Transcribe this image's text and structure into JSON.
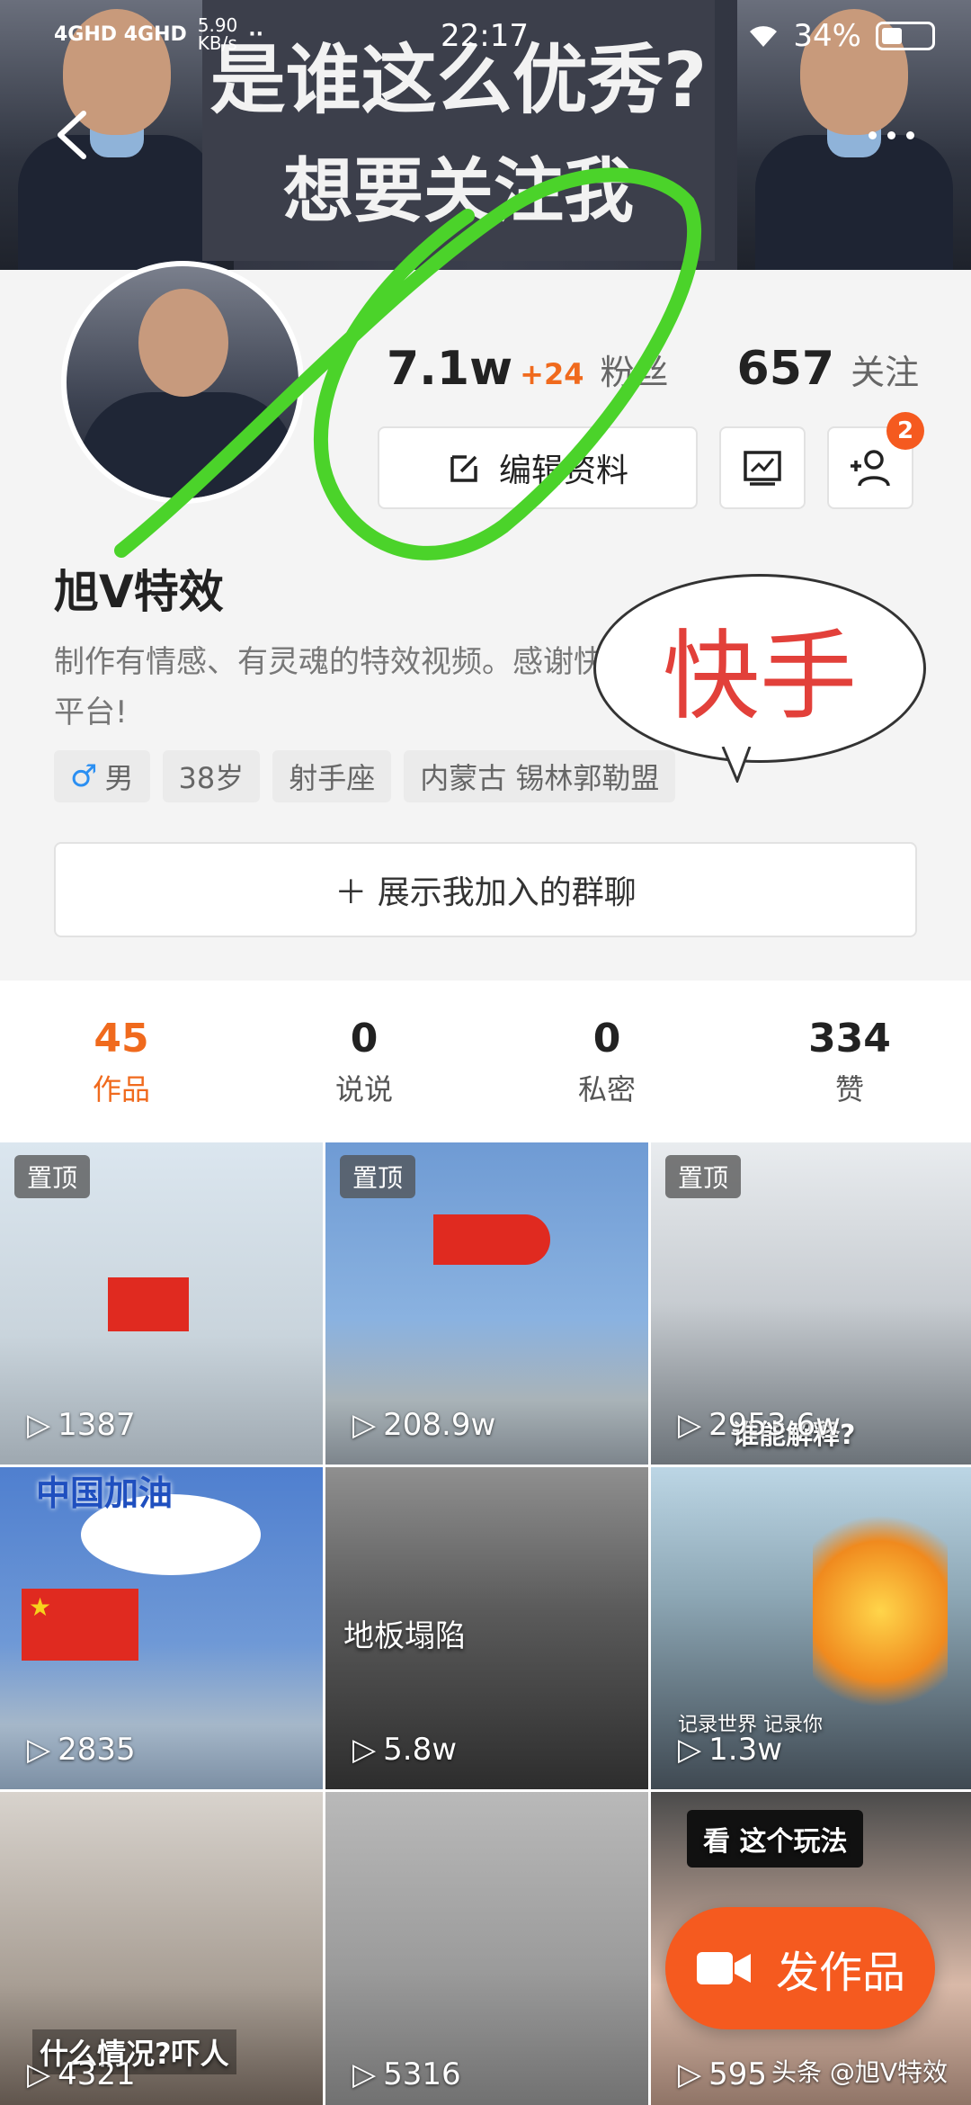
{
  "status_bar": {
    "network": "4GHD 4GHD",
    "speed": "5.90",
    "speed_unit": "KB/s",
    "time": "22:17",
    "battery": "34%"
  },
  "banner": {
    "line1": "是谁这么优秀?",
    "line2": "想要关注我"
  },
  "profile": {
    "followers": "7.1w",
    "followers_increase": "+24",
    "followers_label": "粉丝",
    "following": "657",
    "following_label": "关注",
    "edit_label": "编辑资料",
    "friend_badge": "2",
    "username": "旭V特效",
    "bio": "制作有情感、有灵魂的特效视频。感谢快手平台!",
    "tags": {
      "gender_symbol": "♂",
      "gender": "男",
      "age": "38岁",
      "zodiac": "射手座",
      "location": "内蒙古 锡林郭勒盟"
    },
    "bubble_text": "快手",
    "group_chat_label": "＋ 展示我加入的群聊"
  },
  "tabs": [
    {
      "count": "45",
      "label": "作品"
    },
    {
      "count": "0",
      "label": "说说"
    },
    {
      "count": "0",
      "label": "私密"
    },
    {
      "count": "334",
      "label": "赞"
    }
  ],
  "grid": [
    {
      "pin": "置顶",
      "plays": "1387"
    },
    {
      "pin": "置顶",
      "plays": "208.9w"
    },
    {
      "pin": "置顶",
      "plays": "2953.6w",
      "caption": "谁能解释?"
    },
    {
      "plays": "2835",
      "caption": "中国加油"
    },
    {
      "plays": "5.8w",
      "caption": "地板塌陷"
    },
    {
      "plays": "1.3w",
      "caption": "记录世界 记录你"
    },
    {
      "plays": "4321",
      "caption": "什么情况?吓人"
    },
    {
      "plays": "5316"
    },
    {
      "plays": "595",
      "caption": "看 这个玩法"
    }
  ],
  "fab": {
    "label": "发作品"
  },
  "watermark": "头条 @旭V特效",
  "colors": {
    "accent": "#f06a1d",
    "fab": "#f55a1f",
    "annotation": "#4bd32a",
    "bubble_text": "#e2403a"
  }
}
